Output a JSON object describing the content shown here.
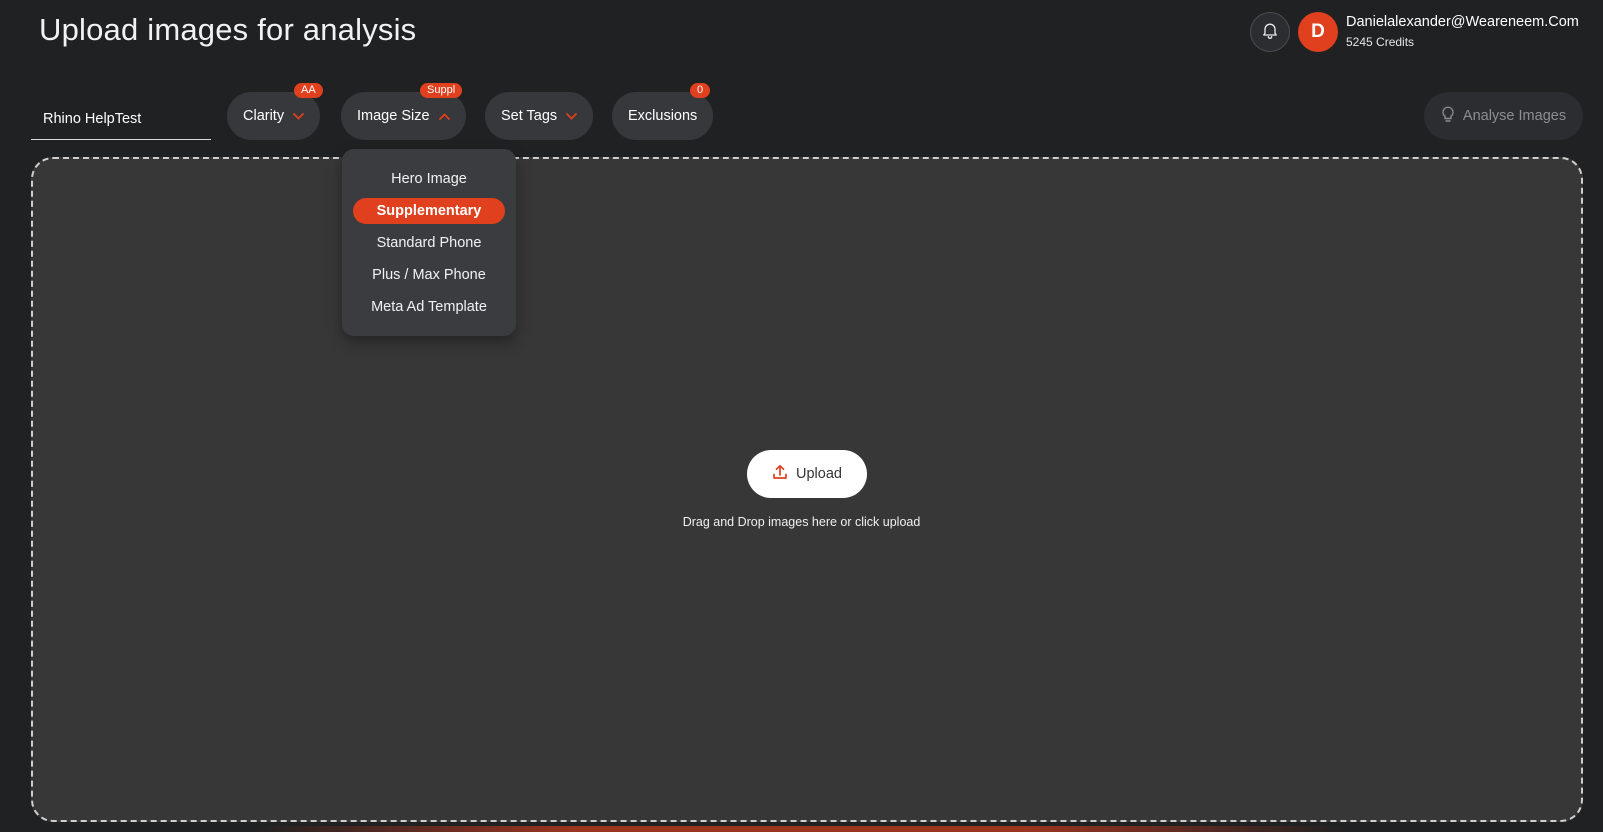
{
  "header": {
    "title": "Upload images for analysis",
    "user": {
      "initial": "D",
      "email": "Danielalexander@Weareneem.Com",
      "credits": "5245 Credits"
    },
    "bell_icon": "bell-icon"
  },
  "toolbar": {
    "name_input": {
      "value": "Rhino HelpTest",
      "placeholder": ""
    },
    "filters": [
      {
        "label": "Clarity",
        "badge": "AA",
        "icon": "chevron-down-icon"
      },
      {
        "label": "Image Size",
        "badge": "Suppl",
        "icon": "chevron-up-icon",
        "expanded": true
      },
      {
        "label": "Set Tags",
        "badge": "",
        "icon": "chevron-down-icon"
      },
      {
        "label": "Exclusions",
        "badge": "0"
      }
    ],
    "analyse_label": "Analyse Images",
    "analyse_icon": "lightbulb-icon"
  },
  "image_size_menu": {
    "options": [
      "Hero Image",
      "Supplementary",
      "Standard Phone",
      "Plus / Max Phone",
      "Meta Ad Template"
    ],
    "selected": "Supplementary"
  },
  "dropzone": {
    "upload_label": "Upload",
    "upload_icon": "upload-icon",
    "hint": "Drag and Drop images here or click upload"
  },
  "colors": {
    "accent": "#e0401e",
    "background": "#1f2123",
    "dropzone": "#373737",
    "pill": "#36383b"
  }
}
